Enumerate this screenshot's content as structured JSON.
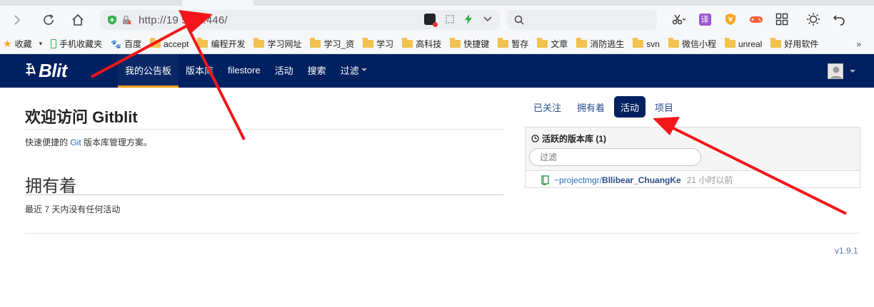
{
  "browser": {
    "url": "http://19   5.33:446/",
    "bookmarks": [
      {
        "label": "收藏",
        "kind": "star"
      },
      {
        "label": "手机收藏夹",
        "kind": "phone"
      },
      {
        "label": "百度",
        "kind": "baidu"
      },
      {
        "label": "accept",
        "kind": "folder"
      },
      {
        "label": "编程开发",
        "kind": "folder"
      },
      {
        "label": "学习网址",
        "kind": "folder"
      },
      {
        "label": "学习_资",
        "kind": "folder"
      },
      {
        "label": "学习",
        "kind": "folder"
      },
      {
        "label": "高科技",
        "kind": "folder"
      },
      {
        "label": "快捷键",
        "kind": "folder"
      },
      {
        "label": "暂存",
        "kind": "folder"
      },
      {
        "label": "文章",
        "kind": "folder"
      },
      {
        "label": "消防逃生",
        "kind": "folder"
      },
      {
        "label": "svn",
        "kind": "folder"
      },
      {
        "label": "微信小程",
        "kind": "folder"
      },
      {
        "label": "unreal",
        "kind": "folder"
      },
      {
        "label": "好用软件",
        "kind": "folder"
      }
    ],
    "bookmarks_more": "»",
    "translate_label": "译"
  },
  "navbar": {
    "brand": "Blit",
    "items": [
      "我的公告板",
      "版本库",
      "filestore",
      "活动",
      "搜索",
      "过滤"
    ]
  },
  "main": {
    "welcome_title": "欢迎访问 Gitblit",
    "desc_prefix": "快速便捷的 ",
    "desc_link": "Git",
    "desc_suffix": " 版本库管理方案。",
    "owned_title": "拥有着",
    "no_activity": "最近 7 天内没有任何活动"
  },
  "sidebar": {
    "tabs": [
      "已关注",
      "拥有着",
      "活动",
      "项目"
    ],
    "active_tab": "活动",
    "panel_title": "活跃的版本库 (1)",
    "filter_placeholder": "过滤",
    "repos": [
      {
        "owner": "~projectmgr/",
        "name": "Bllibear_ChuangKe",
        "time": "21 小时以前"
      }
    ]
  },
  "footer": {
    "version": "v1.9.1"
  },
  "colors": {
    "navbar_bg": "#002060",
    "active_underline": "#f59c1a",
    "link": "#2a6ebb",
    "arrow": "#f2161a"
  }
}
